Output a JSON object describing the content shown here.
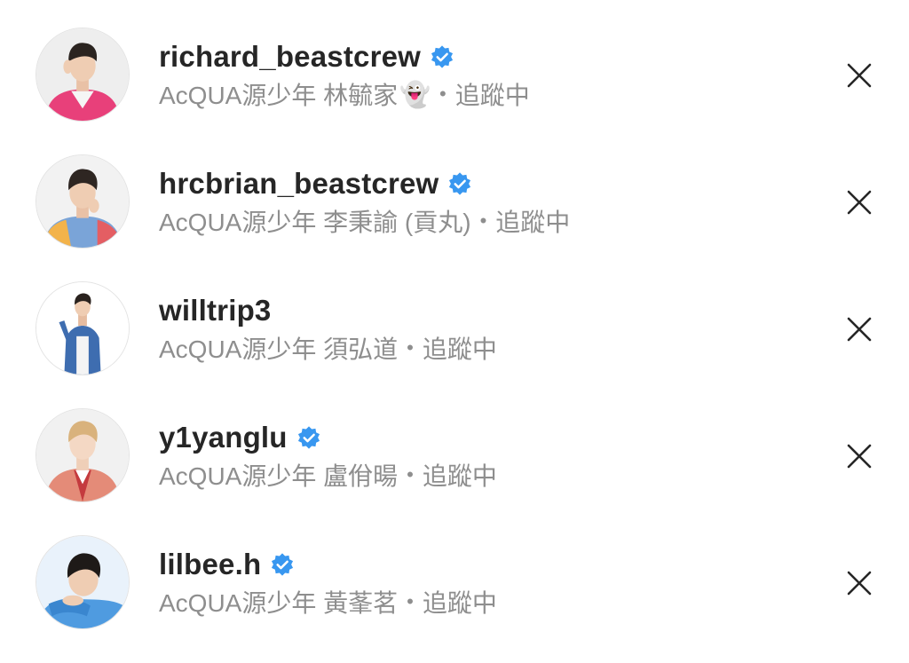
{
  "accounts": [
    {
      "username": "richard_beastcrew",
      "verified": true,
      "subtitle": "AcQUA源少年 林毓家",
      "emoji": "👻",
      "status": "追蹤中",
      "avatar_bg": "#eeeeee",
      "jacket_color": "#e8407a"
    },
    {
      "username": "hrcbrian_beastcrew",
      "verified": true,
      "subtitle": "AcQUA源少年 李秉諭 (貢丸)",
      "emoji": "",
      "status": "追蹤中",
      "avatar_bg": "#f2f2f2",
      "jacket_color": "#7aa4d8"
    },
    {
      "username": "willtrip3",
      "verified": false,
      "subtitle": "AcQUA源少年 須弘道",
      "emoji": "",
      "status": "追蹤中",
      "avatar_bg": "#ffffff",
      "jacket_color": "#3e6db0"
    },
    {
      "username": "y1yanglu",
      "verified": true,
      "subtitle": "AcQUA源少年 盧佾暘",
      "emoji": "",
      "status": "追蹤中",
      "avatar_bg": "#f1f1f1",
      "jacket_color": "#e48b78"
    },
    {
      "username": "lilbee.h",
      "verified": true,
      "subtitle": "AcQUA源少年 黃莑茗",
      "emoji": "",
      "status": "追蹤中",
      "avatar_bg": "#e9f2fb",
      "jacket_color": "#4f9be0"
    }
  ],
  "icons": {
    "verified": "verified-badge-icon",
    "remove": "close-icon"
  },
  "colors": {
    "verified_blue": "#3897f0",
    "username": "#262626",
    "secondary_text": "#8e8e8e",
    "close_icon": "#262626"
  }
}
